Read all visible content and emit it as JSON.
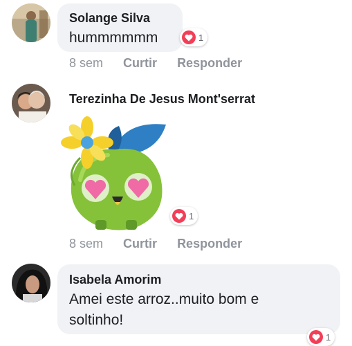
{
  "comments": [
    {
      "author": "Solange Silva",
      "text": "hummmmmm",
      "reaction_count": "1",
      "time": "8 sem",
      "like_label": "Curtir",
      "reply_label": "Responder"
    },
    {
      "author": "Terezinha De Jesus Mont'serrat",
      "sticker": "green-apple-heart-eyes-sticker",
      "reaction_count": "1",
      "time": "8 sem",
      "like_label": "Curtir",
      "reply_label": "Responder"
    },
    {
      "author": "Isabela Amorim",
      "text_line1": "Amei este arroz..muito bom e",
      "text_line2": "soltinho!",
      "reaction_count": "1"
    }
  ],
  "colors": {
    "bubble": "#f0f2f5",
    "love": "#f33e58",
    "meta": "#90949c"
  }
}
